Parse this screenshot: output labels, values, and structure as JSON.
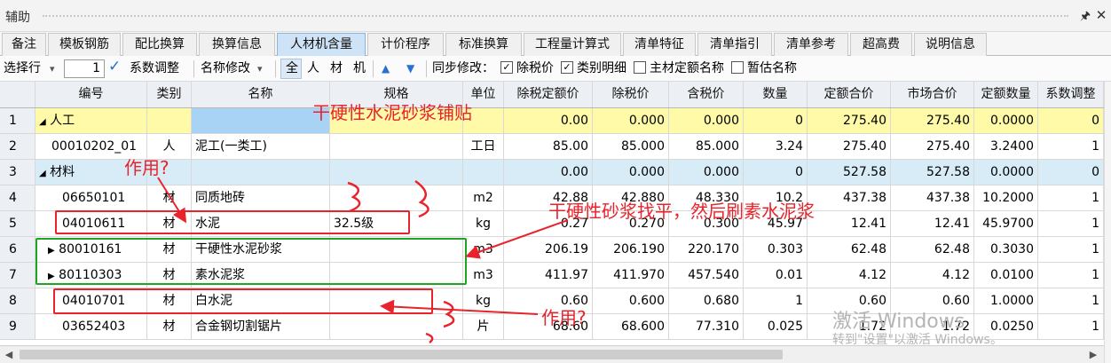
{
  "panel": {
    "title": "辅助",
    "pin_glyph": "🖈",
    "close_glyph": "✕"
  },
  "tabs": [
    "备注",
    "模板钢筋",
    "配比换算",
    "换算信息",
    "人材机含量",
    "计价程序",
    "标准换算",
    "工程量计算式",
    "清单特征",
    "清单指引",
    "清单参考",
    "超高费",
    "说明信息"
  ],
  "active_tab": 4,
  "toolbar": {
    "select_row": "选择行",
    "dropdown_arrow": "▾",
    "row_value": "1",
    "coef_adjust": "系数调整",
    "rename": "名称修改",
    "seg_all": "全",
    "seg_labor": "人",
    "seg_material": "材",
    "seg_machine": "机",
    "sync_label": "同步修改：",
    "tax_excl": "除税价",
    "category_detail": "类别明细",
    "main_quota_name": "主材定额名称",
    "estimate_name": "暂估名称",
    "checked_mark": "✓"
  },
  "columns": [
    "",
    "编号",
    "类别",
    "名称",
    "规格",
    "单位",
    "除税定额价",
    "除税价",
    "含税价",
    "数量",
    "定额合价",
    "市场合价",
    "定额数量",
    "系数调整"
  ],
  "rows": [
    {
      "n": "1",
      "code": "人工",
      "cat": "",
      "name": "",
      "spec": "",
      "unit": "",
      "p1": "0.00",
      "p2": "0.000",
      "p3": "0.000",
      "qty": "0",
      "t1": "275.40",
      "t2": "275.40",
      "qq": "0.0000",
      "coef": "0",
      "group": "yellow",
      "marker": "◢"
    },
    {
      "n": "2",
      "code": "00010202_01",
      "cat": "人",
      "name": "泥工(一类工)",
      "spec": "",
      "unit": "工日",
      "p1": "85.00",
      "p2": "85.000",
      "p3": "85.000",
      "qty": "3.24",
      "t1": "275.40",
      "t2": "275.40",
      "qq": "3.2400",
      "coef": "1",
      "group": "",
      "marker": ""
    },
    {
      "n": "3",
      "code": "材料",
      "cat": "",
      "name": "",
      "spec": "",
      "unit": "",
      "p1": "0.00",
      "p2": "0.000",
      "p3": "0.000",
      "qty": "0",
      "t1": "527.58",
      "t2": "527.58",
      "qq": "0.0000",
      "coef": "0",
      "group": "blue",
      "marker": "◢"
    },
    {
      "n": "4",
      "code": "06650101",
      "cat": "材",
      "name": "同质地砖",
      "spec": "",
      "unit": "m2",
      "p1": "42.88",
      "p2": "42.880",
      "p3": "48.330",
      "qty": "10.2",
      "t1": "437.38",
      "t2": "437.38",
      "qq": "10.2000",
      "coef": "1",
      "group": "",
      "marker": ""
    },
    {
      "n": "5",
      "code": "04010611",
      "cat": "材",
      "name": "水泥",
      "spec": "32.5级",
      "unit": "kg",
      "p1": "0.27",
      "p2": "0.270",
      "p3": "0.300",
      "qty": "45.97",
      "t1": "12.41",
      "t2": "12.41",
      "qq": "45.9700",
      "coef": "1",
      "group": "",
      "marker": ""
    },
    {
      "n": "6",
      "code": "80010161",
      "cat": "材",
      "name": "干硬性水泥砂浆",
      "spec": "",
      "unit": "m3",
      "p1": "206.19",
      "p2": "206.190",
      "p3": "220.170",
      "qty": "0.303",
      "t1": "62.48",
      "t2": "62.48",
      "qq": "0.3030",
      "coef": "1",
      "group": "",
      "marker": "▶"
    },
    {
      "n": "7",
      "code": "80110303",
      "cat": "材",
      "name": "素水泥浆",
      "spec": "",
      "unit": "m3",
      "p1": "411.97",
      "p2": "411.970",
      "p3": "457.540",
      "qty": "0.01",
      "t1": "4.12",
      "t2": "4.12",
      "qq": "0.0100",
      "coef": "1",
      "group": "",
      "marker": "▶"
    },
    {
      "n": "8",
      "code": "04010701",
      "cat": "材",
      "name": "白水泥",
      "spec": "",
      "unit": "kg",
      "p1": "0.60",
      "p2": "0.600",
      "p3": "0.680",
      "qty": "1",
      "t1": "0.60",
      "t2": "0.60",
      "qq": "1.0000",
      "coef": "1",
      "group": "",
      "marker": ""
    },
    {
      "n": "9",
      "code": "03652403",
      "cat": "材",
      "name": "合金钢切割锯片",
      "spec": "",
      "unit": "片",
      "p1": "68.60",
      "p2": "68.600",
      "p3": "77.310",
      "qty": "0.025",
      "t1": "1.72",
      "t2": "1.72",
      "qq": "0.0250",
      "coef": "1",
      "group": "",
      "marker": ""
    }
  ],
  "annotations": {
    "title_note": "干硬性水泥砂浆铺贴",
    "purpose_top": "作用?",
    "process_note": "干硬性砂浆找平，然后刷素水泥浆",
    "purpose_bottom": "作用?"
  },
  "watermark": {
    "line1": "激活 Windows",
    "line2": "转到\"设置\"以激活 Windows。"
  },
  "scroll": {
    "left_arrow": "◀",
    "right_arrow": "▶"
  },
  "colors": {
    "annotation_red": "#e8232b",
    "annotation_green": "#1ea620",
    "group_yellow": "#fffaa8",
    "group_blue": "#d8ecf8",
    "active_tab": "#cfe3f6"
  }
}
